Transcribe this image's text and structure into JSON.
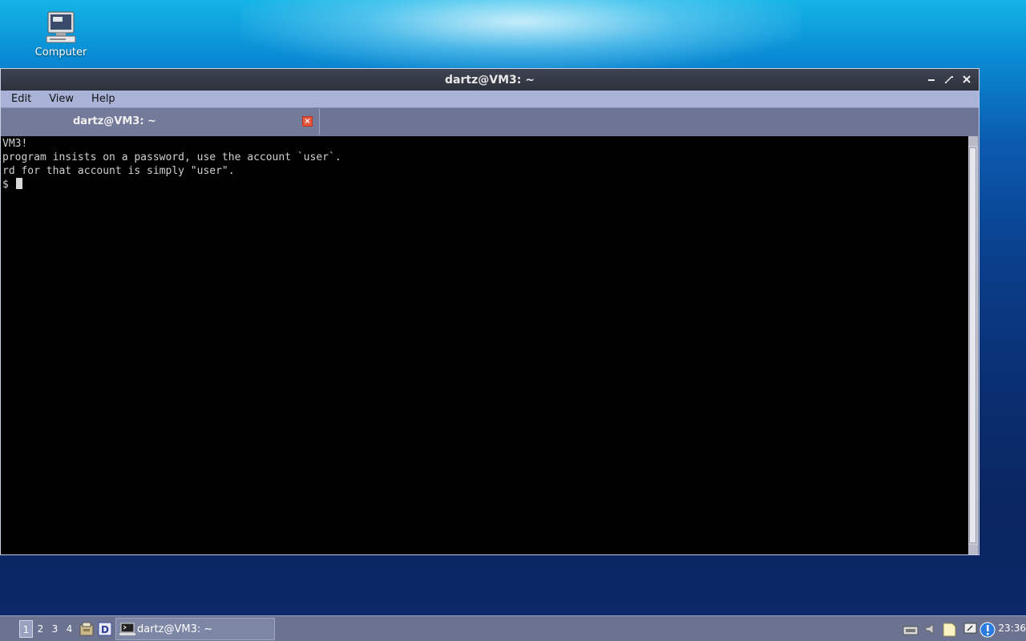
{
  "desktop": {
    "icons": [
      {
        "label": "Computer",
        "icon": "computer-icon"
      }
    ]
  },
  "window": {
    "title": "dartz@VM3: ~",
    "controls": [
      "minimize",
      "maximize",
      "close"
    ],
    "menu": [
      "Edit",
      "View",
      "Help"
    ],
    "tabs": [
      {
        "label": "dartz@VM3: ~",
        "close_icon": "tab-close-icon",
        "close_color": "#e8553d"
      }
    ],
    "terminal": {
      "lines": [
        "VM3!",
        "program insists on a password, use the account `user`.",
        "rd for that account is simply \"user\".",
        "$ "
      ],
      "background": "#000000",
      "foreground": "#cfcfcf"
    }
  },
  "taskbar": {
    "workspaces": [
      "1",
      "2",
      "3",
      "4"
    ],
    "active_workspace": "1",
    "launchers": [
      "file-manager-icon",
      "document-viewer-icon"
    ],
    "tasks": [
      {
        "label": "dartz@VM3: ~",
        "icon": "terminal-icon"
      }
    ],
    "tray": [
      "network-icon",
      "volume-icon",
      "notes-icon",
      "chat-icon",
      "update-alert-icon"
    ],
    "clock": "23:36"
  }
}
